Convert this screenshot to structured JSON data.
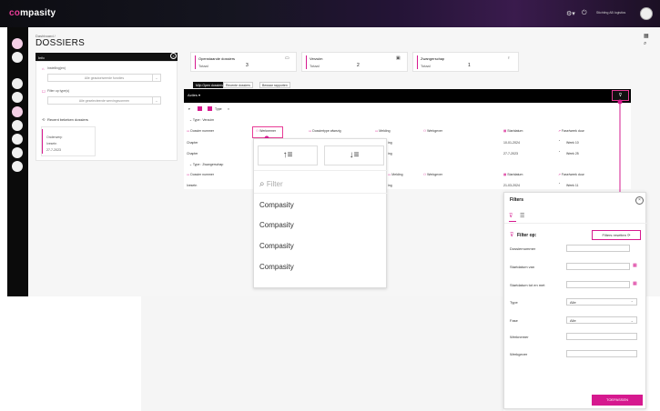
{
  "app": {
    "logo_prefix": "co",
    "logo_rest": "mpasity",
    "user_text": "Stichting AB logistics"
  },
  "header": {
    "breadcrumb": "Dashboard  /",
    "title": "DOSSIERS"
  },
  "info": {
    "title": "Info",
    "field1_label": "Instelling(en)",
    "field1_value": "Alle geautoriseerde functies",
    "field2_label": "Filter op type(s)",
    "field2_value": "Alle geselecteerde wervingsvormen",
    "recent_title": "Recent bekeken dossiers",
    "recent_item": {
      "line1": "Onderwerp",
      "line2": "Ivesetn",
      "line3": "27-7-2023"
    }
  },
  "stats": [
    {
      "label": "Openstaande dossiers",
      "total_label": "Totaal",
      "value": "3",
      "icon": "folder-icon"
    },
    {
      "label": "Verzuim",
      "total_label": "Totaal",
      "value": "2",
      "icon": "briefcase-icon"
    },
    {
      "label": "Zwangerschap",
      "total_label": "Totaal",
      "value": "1",
      "icon": "pregnancy-icon"
    }
  ],
  "tabs": [
    "Mijn Open dossiers",
    "Recente dossiers",
    "Bewaar rapporten"
  ],
  "table": {
    "actions_label": "Acties",
    "type_chip": "Type",
    "group1": "Type : Verzuim",
    "group2": "Type : Zwangerschap",
    "columns": [
      "Dossier nummer",
      "Werknemer",
      "Dossiertype afwezig",
      "Melding",
      "Werkgever",
      "Startdatum",
      "Fase/week duur"
    ],
    "rows": [
      {
        "col1": "Chapter",
        "date": "10-01-2024",
        "status": "Week 10",
        "melding": "ing"
      },
      {
        "col1": "Chapter",
        "date": "27-7-2023",
        "status": "Week 25",
        "melding": "ing"
      },
      {
        "col1": "Ivesetn",
        "date": "21-03-2024",
        "status": "Week 11",
        "melding": "ing"
      }
    ]
  },
  "dropdown": {
    "search_placeholder": "Filter",
    "items": [
      "Compasity",
      "Compasity",
      "Compasity",
      "Compasity"
    ]
  },
  "filters": {
    "title": "Filters",
    "filter_on": "Filter op:",
    "reset": "Filters resetten",
    "fields": [
      "Dossiernummer",
      "Startdatum van",
      "Startdatum tot en met",
      "Type",
      "Fase",
      "Werknemer",
      "Werkgever"
    ],
    "type_value": "Alle",
    "fase_value": "Alle",
    "apply": "TOEPASSEN"
  },
  "colors": {
    "accent": "#d6198f",
    "dark": "#0b0b0b"
  }
}
